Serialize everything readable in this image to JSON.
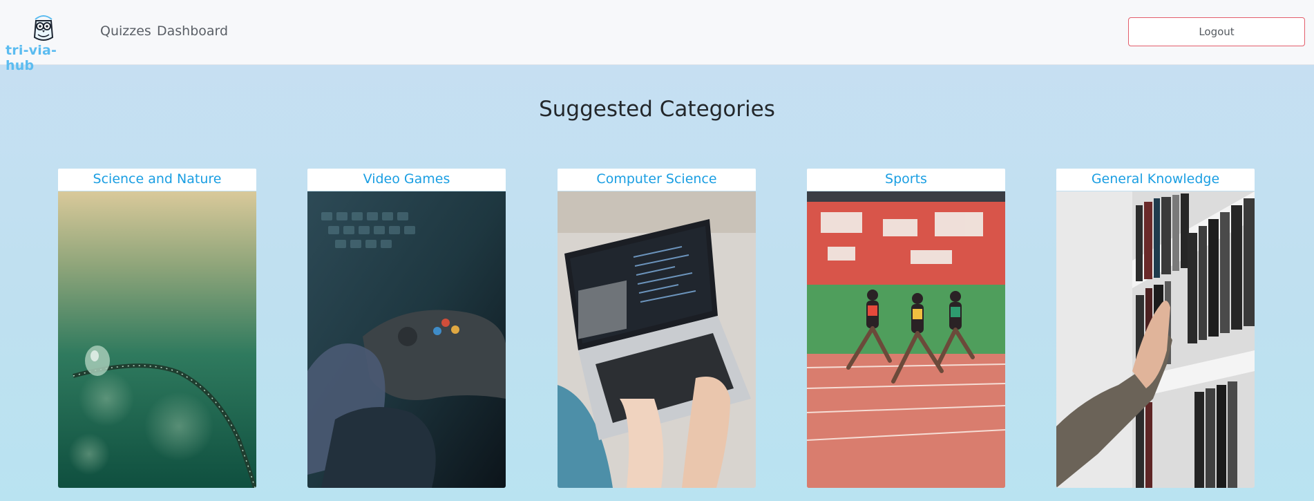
{
  "navbar": {
    "brand": "tri-via-hub",
    "links": [
      {
        "label": "Quizzes"
      },
      {
        "label": "Dashboard"
      }
    ],
    "logout_label": "Logout"
  },
  "main": {
    "title": "Suggested Categories",
    "categories": [
      {
        "label": "Science and Nature",
        "image": "water-droplet-on-leaf"
      },
      {
        "label": "Video Games",
        "image": "game-controller-in-hand"
      },
      {
        "label": "Computer Science",
        "image": "laptop-with-code"
      },
      {
        "label": "Sports",
        "image": "sprinters-on-track"
      },
      {
        "label": "General Knowledge",
        "image": "hand-reaching-bookshelf"
      }
    ]
  },
  "colors": {
    "brand": "#5bbcf0",
    "card_title": "#1a9ee2",
    "logout_border": "#e35d6a",
    "navbar_bg": "#f7f8fa"
  }
}
